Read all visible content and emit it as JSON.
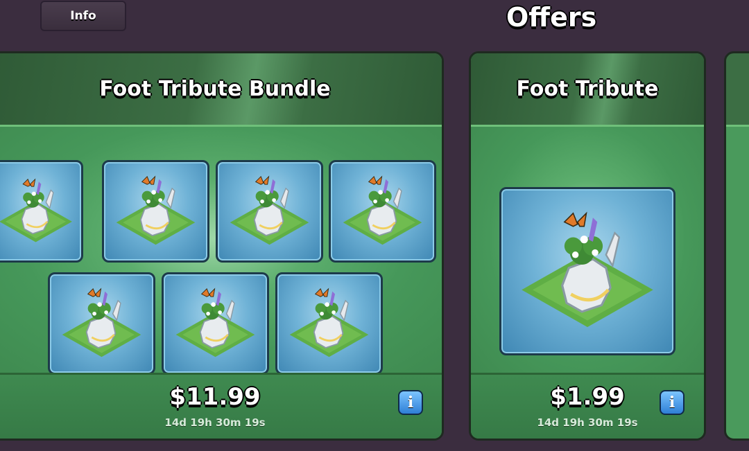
{
  "header": {
    "info_label": "Info",
    "page_title": "Offers"
  },
  "offers": [
    {
      "title": "Foot Tribute Bundle",
      "price": "$11.99",
      "timer": "14d 19h 30m 19s",
      "item_count": 7,
      "item_icon": "foot-tribute-decoration-icon"
    },
    {
      "title": "Foot Tribute",
      "price": "$1.99",
      "timer": "14d 19h 30m 19s",
      "item_count": 1,
      "item_icon": "foot-tribute-decoration-icon"
    }
  ],
  "icons": {
    "info": "info-icon"
  },
  "colors": {
    "background": "#3b2d3f",
    "card_green": "#4a9a5c",
    "tile_blue": "#6fb2d6",
    "info_blue": "#2e7fd6"
  }
}
